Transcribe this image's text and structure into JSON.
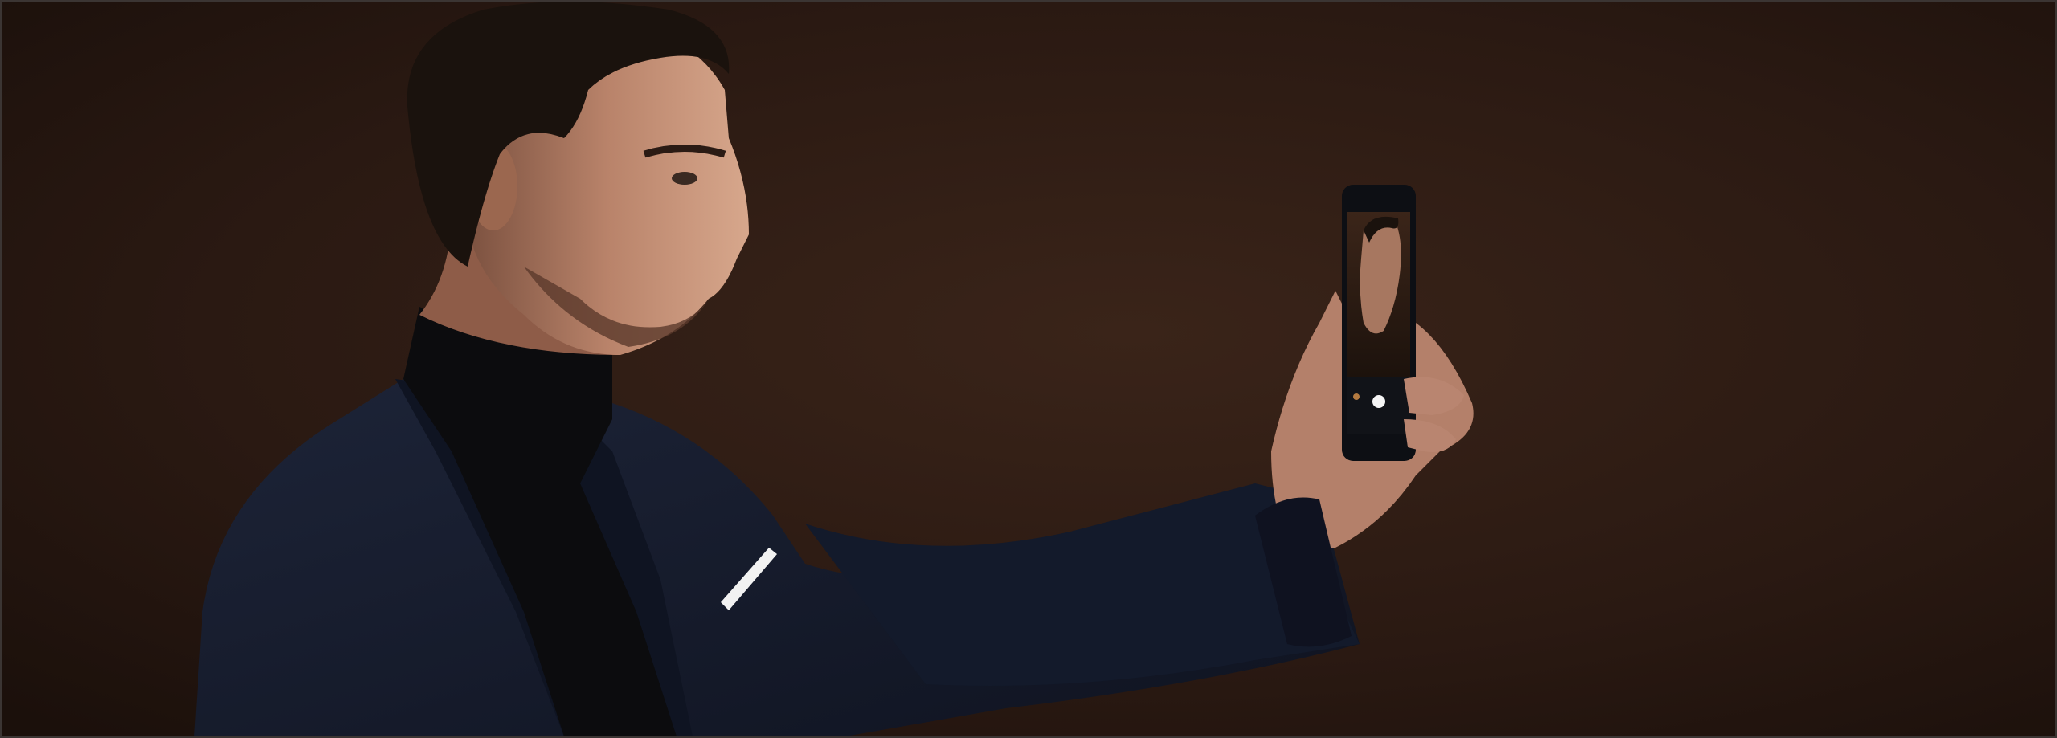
{
  "scene": {
    "background_color": "#24150f",
    "background_highlight": "#3a2419",
    "jacket_color": "#151b2c",
    "turtleneck_color": "#0c0c0e",
    "skin_color": "#b9836a",
    "hair_color": "#1a120d",
    "pocket_square_color": "#f2f2f2",
    "phone_body_color": "#0d0f14",
    "phone_screen_color": "#2b1b12"
  }
}
